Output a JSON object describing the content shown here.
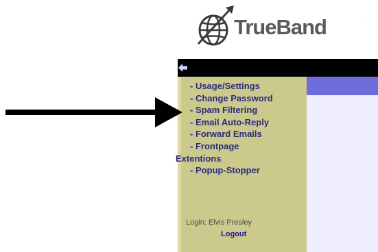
{
  "logo": {
    "brand_name": "TrueBand",
    "tm": "."
  },
  "sidebar": {
    "items": [
      {
        "label": "- Usage/Settings"
      },
      {
        "label": "- Change Password"
      },
      {
        "label": "- Spam Filtering"
      },
      {
        "label": "- Email Auto-Reply"
      },
      {
        "label": "- Forward Emails"
      },
      {
        "label": "- Frontpage"
      },
      {
        "label": "Extentions"
      },
      {
        "label": "- Popup-Stopper"
      }
    ],
    "login_text": "Login: Elvis Presley",
    "logout_label": "Logout"
  },
  "icons": {
    "back": "back-arrow-icon",
    "pointer": "pointer-arrow-icon",
    "logo": "globe-logo-icon"
  },
  "colors": {
    "sidebar_bg": "#ccc98d",
    "menu_text": "#2b2b7a",
    "header_band": "#6e6edb",
    "content_bg": "#eeeefe",
    "topbar": "#000000",
    "logo_text": "#5a5a5a"
  }
}
